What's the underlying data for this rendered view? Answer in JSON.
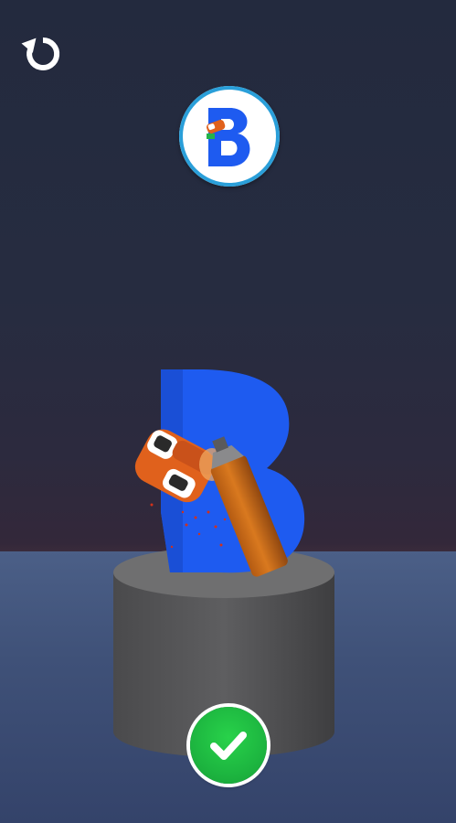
{
  "game": {
    "target_letter": "B",
    "colors": {
      "letter_blue": "#1e5bf0",
      "paint_orange": "#e0611c",
      "confirm_green": "#1db640",
      "badge_ring": "#2a9fd9"
    }
  },
  "controls": {
    "restart_icon": "restart-icon",
    "confirm_icon": "checkmark-icon"
  }
}
